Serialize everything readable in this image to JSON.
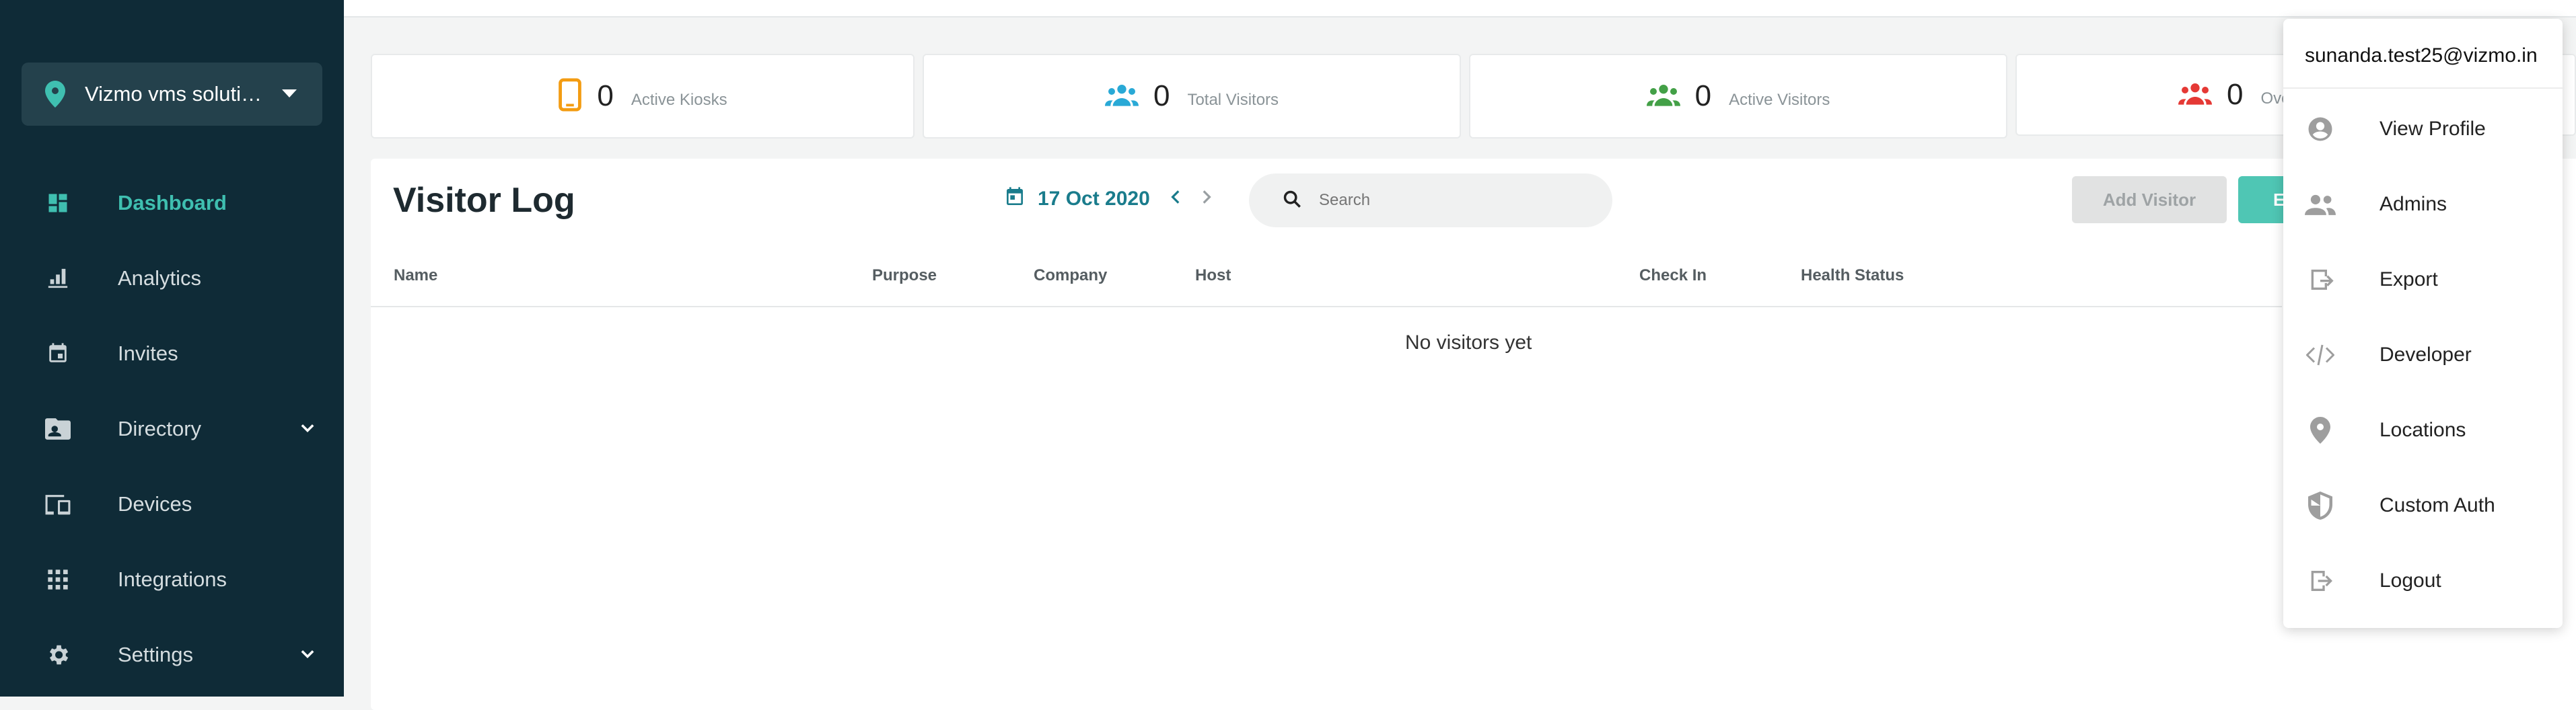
{
  "location_selector": {
    "label": "Vizmo vms soluti…"
  },
  "nav": {
    "items": [
      {
        "label": "Dashboard",
        "icon": "dashboard-icon"
      },
      {
        "label": "Analytics",
        "icon": "analytics-icon"
      },
      {
        "label": "Invites",
        "icon": "calendar-icon"
      },
      {
        "label": "Directory",
        "icon": "directory-icon"
      },
      {
        "label": "Devices",
        "icon": "devices-icon"
      },
      {
        "label": "Integrations",
        "icon": "apps-grid-icon"
      },
      {
        "label": "Settings",
        "icon": "gear-icon"
      }
    ]
  },
  "stats": [
    {
      "value": "0",
      "label": "Active Kiosks",
      "icon": "tablet-icon",
      "color": "#f39c12"
    },
    {
      "value": "0",
      "label": "Total Visitors",
      "icon": "people-icon",
      "color": "#29a9d6"
    },
    {
      "value": "0",
      "label": "Active Visitors",
      "icon": "people-icon",
      "color": "#43a047"
    },
    {
      "value": "0",
      "label": "Ove",
      "icon": "people-icon",
      "color": "#e53935"
    }
  ],
  "visitor_log": {
    "title": "Visitor Log",
    "date": "17 Oct 2020",
    "search_placeholder": "Search",
    "add_visitor": "Add Visitor",
    "export_btn": "E",
    "columns": [
      "Name",
      "Purpose",
      "Company",
      "Host",
      "Check In",
      "Health Status"
    ],
    "empty_message": "No visitors yet"
  },
  "user_menu": {
    "email": "sunanda.test25@vizmo.in",
    "items": [
      {
        "label": "View Profile",
        "icon": "account-circle-icon"
      },
      {
        "label": "Admins",
        "icon": "people-icon"
      },
      {
        "label": "Export",
        "icon": "export-icon"
      },
      {
        "label": "Developer",
        "icon": "code-icon"
      },
      {
        "label": "Locations",
        "icon": "location-pin-icon"
      },
      {
        "label": "Custom Auth",
        "icon": "shield-icon"
      },
      {
        "label": "Logout",
        "icon": "logout-icon"
      }
    ]
  },
  "colors": {
    "sidebar_bg": "#0f2b37",
    "accent": "#3fbfb0",
    "date": "#1a7c8c"
  }
}
